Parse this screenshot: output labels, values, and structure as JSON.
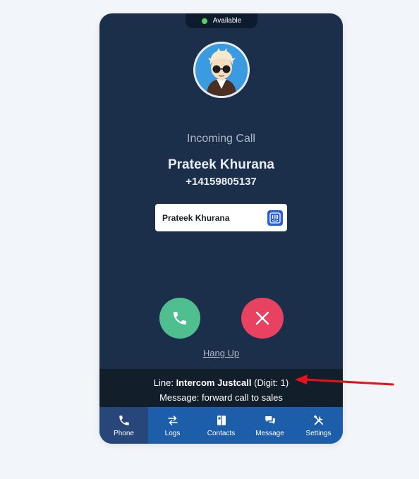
{
  "status": {
    "label": "Available",
    "color": "#58d35a"
  },
  "avatar": {
    "icon": "cartoon-person-avatar"
  },
  "call": {
    "state_label": "Incoming Call",
    "caller_name": "Prateek Khurana",
    "caller_number": "+14159805137"
  },
  "crm_card": {
    "name": "Prateek Khurana",
    "icon": "intercom-icon"
  },
  "actions": {
    "accept_icon": "phone-icon",
    "decline_icon": "close-icon",
    "hangup_label": "Hang Up"
  },
  "line_info": {
    "line_prefix": "Line:",
    "line_name": "Intercom Justcall",
    "digit_text": "(Digit: 1)",
    "message_text": "Message: forward call to sales"
  },
  "nav": {
    "items": [
      {
        "label": "Phone",
        "icon": "phone-icon",
        "active": true
      },
      {
        "label": "Logs",
        "icon": "swap-arrows-icon",
        "active": false
      },
      {
        "label": "Contacts",
        "icon": "contacts-book-icon",
        "active": false
      },
      {
        "label": "Message",
        "icon": "chat-bubbles-icon",
        "active": false
      },
      {
        "label": "Settings",
        "icon": "tools-icon",
        "active": false
      }
    ]
  },
  "colors": {
    "panel": "#1b2f4b",
    "accept": "#4fbf8f",
    "decline": "#e84260",
    "nav": "#1c5ea9",
    "annotation": "#e8101a"
  }
}
